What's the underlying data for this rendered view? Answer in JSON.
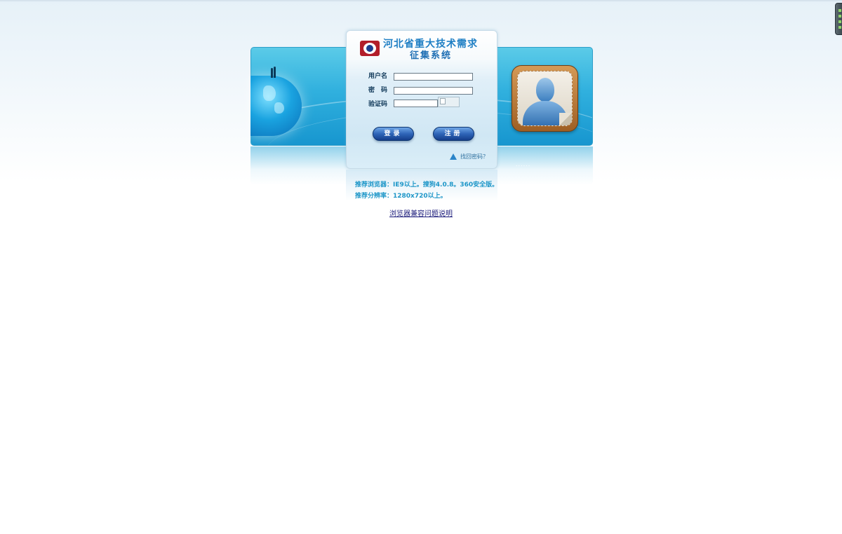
{
  "system": {
    "title_line1": "河北省重大技术需求",
    "title_line2": "征集系统"
  },
  "form": {
    "username_label": "用户名",
    "password_label": "密　码",
    "captcha_label": "验证码",
    "username_value": "",
    "password_value": "",
    "captcha_value": ""
  },
  "buttons": {
    "login_label": "登录",
    "register_label": "注册"
  },
  "forgot": {
    "label": "找回密码？",
    "icon": "warning-triangle-icon"
  },
  "notices": {
    "browser": "推荐浏览器：IE9以上。搜狗4.0.8。360安全版。",
    "resolution": "推荐分辨率：1280x720以上。"
  },
  "links": {
    "compat": "浏览器兼容问题说明"
  },
  "decor": {
    "dots": "......"
  },
  "colors": {
    "banner": "#30b0de",
    "button": "#2e64b8",
    "notice": "#1d96c8",
    "logo": "#b21e2a"
  }
}
